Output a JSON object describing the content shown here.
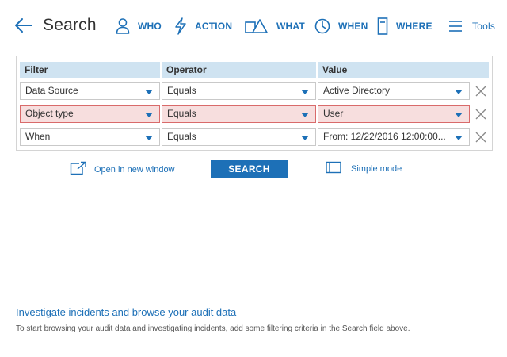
{
  "header": {
    "title": "Search",
    "nav": [
      {
        "label": "WHO",
        "icon": "user-icon"
      },
      {
        "label": "ACTION",
        "icon": "lightning-icon"
      },
      {
        "label": "WHAT",
        "icon": "shapes-icon"
      },
      {
        "label": "WHEN",
        "icon": "clock-icon"
      },
      {
        "label": "WHERE",
        "icon": "server-icon"
      },
      {
        "label": "Tools",
        "icon": "menu-icon"
      }
    ]
  },
  "filters": {
    "columns": [
      "Filter",
      "Operator",
      "Value"
    ],
    "rows": [
      {
        "filter": "Data Source",
        "operator": "Equals",
        "value": "Active Directory",
        "error": false
      },
      {
        "filter": "Object type",
        "operator": "Equals",
        "value": "User",
        "error": true
      },
      {
        "filter": "When",
        "operator": "Equals",
        "value": "From: 12/22/2016 12:00:00...",
        "error": false
      }
    ]
  },
  "actions": {
    "open_new_window": "Open in new window",
    "search": "SEARCH",
    "simple_mode": "Simple mode"
  },
  "info": {
    "title": "Investigate incidents and browse your audit data",
    "text": "To start browsing your audit data and investigating incidents, add some filtering criteria in the Search field above."
  },
  "colors": {
    "accent": "#1d70b7",
    "header_bg": "#cfe3f1",
    "error_bg": "#f7dede",
    "error_border": "#d96a6a"
  }
}
